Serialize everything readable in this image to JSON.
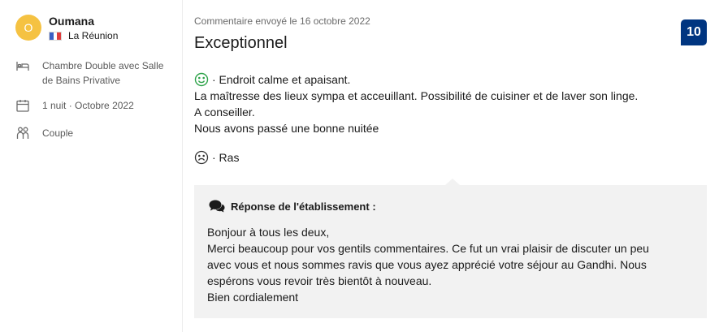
{
  "reviewer": {
    "initial": "O",
    "name": "Oumana",
    "country": "La Réunion",
    "avatar_color": "#f5c242"
  },
  "stay": {
    "room": "Chambre Double avec Salle de Bains Privative",
    "nights": "1 nuit",
    "month": "Octobre 2022",
    "traveler_type": "Couple",
    "room_icon": "bed-icon",
    "date_icon": "calendar-icon",
    "traveler_icon": "people-icon"
  },
  "review": {
    "meta": "Commentaire envoyé le 16 octobre 2022",
    "title": "Exceptionnel",
    "score": "10",
    "score_color": "#003580",
    "positive_icon": "smile-icon",
    "positive_color": "#2ea34a",
    "positive": [
      "· Endroit calme et apaisant.",
      "La maîtresse des lieux sympa et acceuillant. Possibilité de cuisiner et de laver son linge.",
      "A conseiller.",
      "Nous avons passé une bonne nuitée"
    ],
    "negative_icon": "frown-icon",
    "negative": "· Ras"
  },
  "reply": {
    "icon": "chat-bubbles-icon",
    "heading": "Réponse de l'établissement :",
    "lines": [
      "Bonjour à tous les deux,",
      "Merci beaucoup pour vos gentils commentaires. Ce fut un vrai plaisir de discuter un peu",
      "avec vous et nous sommes ravis que vous ayez apprécié votre séjour au Gandhi. Nous",
      "espérons vous revoir très bientôt à nouveau.",
      "Bien cordialement"
    ]
  }
}
